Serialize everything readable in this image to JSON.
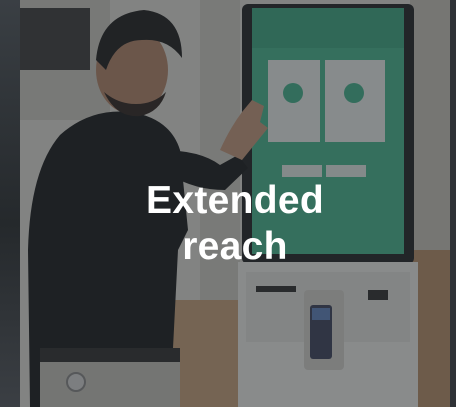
{
  "card": {
    "heading_line1": "Extended",
    "heading_line2": "reach"
  },
  "kiosk_screen": {
    "header_text": "",
    "option_icons": [
      "phone-icon",
      "bag-icon"
    ]
  },
  "colors": {
    "overlay": "#2c3034",
    "kiosk_green": "#3fb58c",
    "text": "#ffffff"
  }
}
